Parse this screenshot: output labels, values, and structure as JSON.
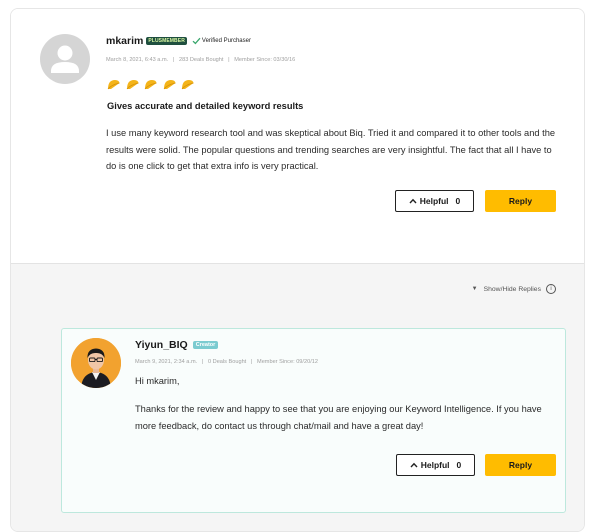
{
  "review": {
    "username": "mkarim",
    "plus_badge": "PLUSMEMBER",
    "verified_label": "Verified Purchaser",
    "date": "March 8, 2021, 6:43 a.m.",
    "deals_bought": "283 Deals Bought",
    "member_since": "Member Since: 03/30/16",
    "rating": 5,
    "rating_max": 5,
    "title": "Gives accurate and detailed keyword results",
    "body": "I use many keyword research tool and was skeptical about Biq. Tried it and compared it to other tools and the results were solid. The popular questions and trending searches are very insightful. The fact that all I have to do is one click to get that extra info is very practical.",
    "helpful_label": "Helpful",
    "helpful_count": "0",
    "reply_label": "Reply"
  },
  "replies_toggle": {
    "label": "Show/Hide Replies",
    "info_glyph": "i"
  },
  "reply": {
    "username": "Yiyun_BIQ",
    "creator_badge": "Creator",
    "date": "March 9, 2021, 2:34 a.m.",
    "deals_bought": "0 Deals Bought",
    "member_since": "Member Since: 09/20/12",
    "greeting": "Hi mkarim,",
    "body": "Thanks for the review and happy to see that you are enjoying our Keyword Intelligence. If you have more feedback, do contact us through chat/mail and have a great day!",
    "helpful_label": "Helpful",
    "helpful_count": "0",
    "reply_label": "Reply"
  },
  "separator": "|",
  "colors": {
    "accent_button": "#ffbc00",
    "star_gold": "#f4b419",
    "plus_badge_bg": "#1f4f3f",
    "creator_badge_bg": "#7bcbd0",
    "verified_check": "#3aa76d",
    "reply_card_border": "#bde8dd"
  },
  "icons": {
    "avatar": "user-avatar-placeholder-icon",
    "star": "taco-star-icon",
    "verified": "checkmark-icon",
    "helpful": "chevron-up-icon",
    "toggle": "triangle-down-icon",
    "info": "info-circle-icon"
  }
}
